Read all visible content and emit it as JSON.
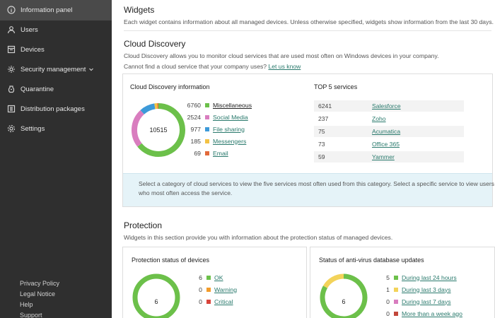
{
  "sidebar": {
    "items": [
      {
        "label": "Information panel",
        "icon": "info-icon",
        "active": true
      },
      {
        "label": "Users",
        "icon": "user-icon"
      },
      {
        "label": "Devices",
        "icon": "device-icon"
      },
      {
        "label": "Security management",
        "icon": "shield-icon"
      },
      {
        "label": "Quarantine",
        "icon": "quarantine-icon"
      },
      {
        "label": "Distribution packages",
        "icon": "package-icon"
      },
      {
        "label": "Settings",
        "icon": "gear-icon"
      }
    ],
    "footer": [
      "Privacy Policy",
      "Legal Notice",
      "Help",
      "Support"
    ]
  },
  "widgets": {
    "title": "Widgets",
    "desc": "Each widget contains information about all managed devices. Unless otherwise specified, widgets show information from the last 30 days."
  },
  "cloud": {
    "title": "Cloud Discovery",
    "desc": "Cloud Discovery allows you to monitor cloud services that are used most often on Windows devices in your company.",
    "question": "Cannot find a cloud service that your company uses?",
    "question_link": "Let us know",
    "card_title": "Cloud Discovery information",
    "total": "10515",
    "categories": [
      {
        "value": "6760",
        "label": "Miscellaneous",
        "color": "#6cc04a"
      },
      {
        "value": "2524",
        "label": "Social Media",
        "color": "#d97dbf"
      },
      {
        "value": "977",
        "label": "File sharing",
        "color": "#3d9ad9"
      },
      {
        "value": "185",
        "label": "Messengers",
        "color": "#f3c244"
      },
      {
        "value": "69",
        "label": "Email",
        "color": "#e26a3b"
      }
    ],
    "top_title": "TOP 5 services",
    "top": [
      {
        "value": "6241",
        "name": "Salesforce"
      },
      {
        "value": "237",
        "name": "Zoho"
      },
      {
        "value": "75",
        "name": "Acumatica"
      },
      {
        "value": "73",
        "name": "Office 365"
      },
      {
        "value": "59",
        "name": "Yammer"
      }
    ],
    "hint_line1": "Select a category of cloud services to view the five services most often used from this category. Select a specific service to view users",
    "hint_line2": "who most often access the service."
  },
  "protection": {
    "title": "Protection",
    "desc": "Widgets in this section provide you with information about the protection status of managed devices.",
    "status_card": {
      "title": "Protection status of devices",
      "total": "6",
      "rows": [
        {
          "value": "6",
          "label": "OK",
          "color": "#6cc04a"
        },
        {
          "value": "0",
          "label": "Warning",
          "color": "#f39c2b"
        },
        {
          "value": "0",
          "label": "Critical",
          "color": "#d9443b"
        }
      ]
    },
    "updates_card": {
      "title": "Status of anti-virus database updates",
      "total": "6",
      "rows": [
        {
          "value": "5",
          "label": "During last 24 hours",
          "color": "#6cc04a"
        },
        {
          "value": "1",
          "label": "During last 3 days",
          "color": "#f3d35a"
        },
        {
          "value": "0",
          "label": "During last 7 days",
          "color": "#d97dbf"
        },
        {
          "value": "0",
          "label": "More than a week ago",
          "color": "#c2473b"
        }
      ]
    }
  }
}
